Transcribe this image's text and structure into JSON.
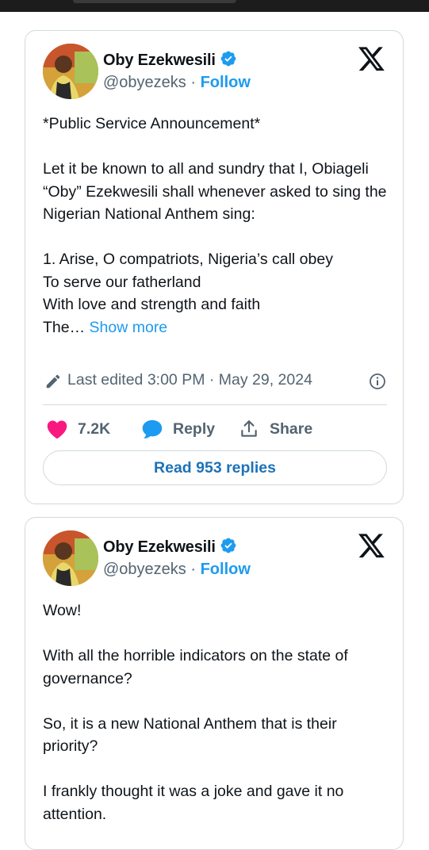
{
  "colors": {
    "accent": "#1d9bf0",
    "like": "#f91880",
    "text": "#0f1419",
    "muted": "#536471",
    "border": "#cfd9de"
  },
  "tweets": [
    {
      "author": {
        "name": "Oby Ezekwesili",
        "handle": "@obyezeks",
        "separator": "·",
        "follow_label": "Follow"
      },
      "paragraphs": [
        "*Public Service Announcement*",
        "Let it be known to all and sundry that I, Obiageli “Oby” Ezekwesili shall whenever asked to sing the Nigerian National Anthem sing:"
      ],
      "anthem_lines": [
        "1. Arise, O compatriots, Nigeria’s call obey",
        "To serve our fatherland",
        "With love and strength and faith"
      ],
      "truncated_line": "The…",
      "show_more_label": "Show more",
      "edited": "Last edited 3:00 PM · May 29, 2024",
      "likes": "7.2K",
      "reply_label": "Reply",
      "share_label": "Share",
      "read_replies_label": "Read 953 replies"
    },
    {
      "author": {
        "name": "Oby Ezekwesili",
        "handle": "@obyezeks",
        "separator": "·",
        "follow_label": "Follow"
      },
      "paragraphs": [
        "Wow!",
        "With all the horrible indicators on the state of governance?",
        "So, it is a new National Anthem that is their priority?",
        "I frankly thought it was a joke and gave it no attention."
      ]
    }
  ]
}
